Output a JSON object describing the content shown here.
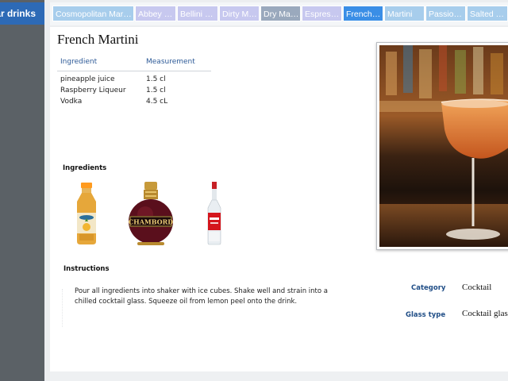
{
  "sidebar": {
    "title": "ar drinks"
  },
  "tabs": [
    {
      "label": "Cosmopolitan Martini",
      "style": "blue"
    },
    {
      "label": "Abbey Martini",
      "style": "lav"
    },
    {
      "label": "Bellini Martini",
      "style": "lav"
    },
    {
      "label": "Dirty Martini",
      "style": "lav"
    },
    {
      "label": "Dry Martini",
      "style": "gray"
    },
    {
      "label": "Espresso Martini",
      "style": "lav"
    },
    {
      "label": "French Martini",
      "style": "active"
    },
    {
      "label": "Martini",
      "style": "blue"
    },
    {
      "label": "Passion Fruit Martini",
      "style": "blue"
    },
    {
      "label": "Salted Toffee Martini",
      "style": "blue"
    }
  ],
  "drink": {
    "name": "French Martini",
    "table": {
      "headers": [
        "Ingredient",
        "Measurement"
      ],
      "rows": [
        [
          "pineapple juice",
          "1.5 cl"
        ],
        [
          "Raspberry Liqueur",
          "1.5 cl"
        ],
        [
          "Vodka",
          "4.5 cL"
        ]
      ]
    },
    "ingredients_heading": "Ingredients",
    "bottle_label": "CHAMBORD",
    "instructions_heading": "Instructions",
    "instructions": "Pour all ingredients into shaker with ice cubes. Shake well and strain into a chilled cocktail glass. Squeeze oil from lemon peel onto the drink.",
    "category_label": "Category",
    "category": "Cocktail",
    "glass_label": "Glass type",
    "glass": "Cocktail glass"
  },
  "colors": {
    "accent": "#2d6ab6",
    "tab_active": "#3a8ee6",
    "tab": "#a7cdec",
    "header_text": "#2d5a97",
    "drink": "#d9773a"
  }
}
